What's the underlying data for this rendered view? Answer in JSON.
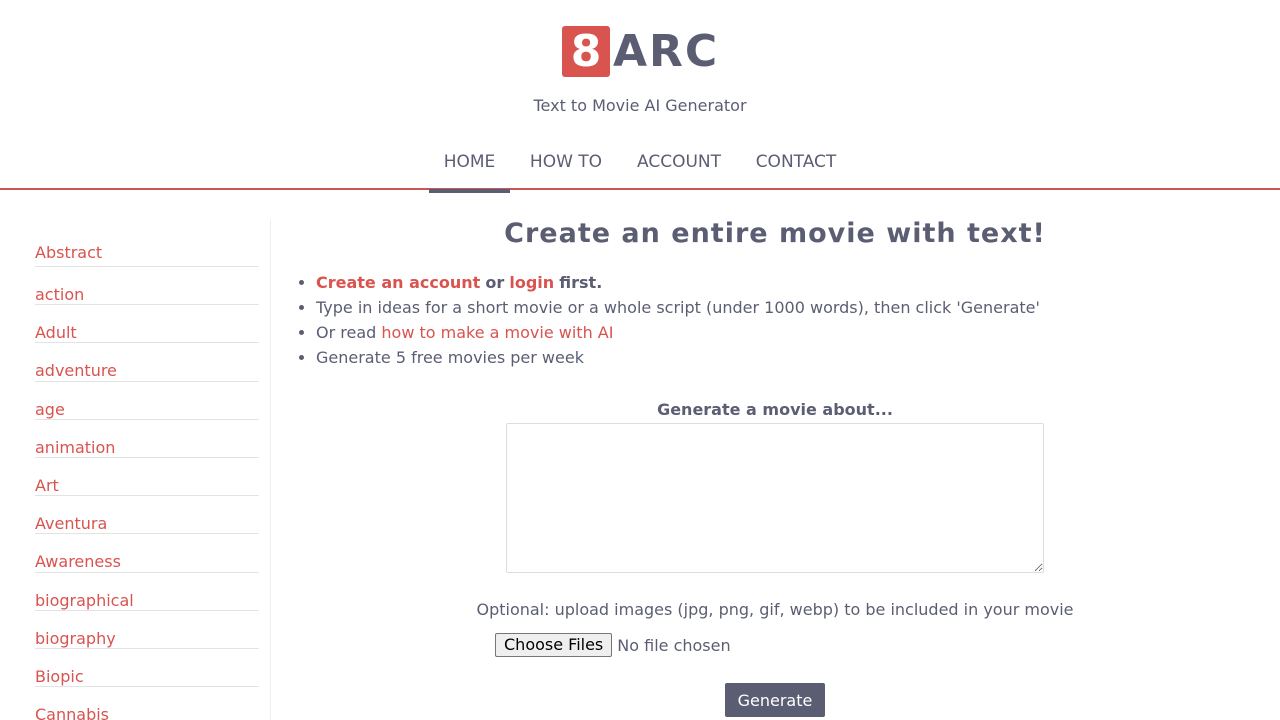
{
  "brand": {
    "logo_number": "8",
    "logo_text": "ARC",
    "tagline": "Text to Movie AI Generator",
    "accent": "#d9534f",
    "text_color": "#5b5e73"
  },
  "nav": {
    "home": "HOME",
    "howto": "HOW TO",
    "account": "ACCOUNT",
    "contact": "CONTACT",
    "active": "HOME"
  },
  "sidebar": {
    "items": [
      "Abstract",
      "action",
      "Adult",
      "adventure",
      "age",
      "animation",
      "Art",
      "Aventura",
      "Awareness",
      "biographical",
      "biography",
      "Biopic",
      "Cannabis"
    ]
  },
  "main": {
    "title": "Create an entire movie with text!",
    "bullet1": {
      "create_link": "Create an account",
      "or": "or",
      "login_link": "login",
      "first": "first."
    },
    "bullet2": "Type in ideas for a short movie or a whole script (under 1000 words), then click 'Generate'",
    "bullet3": {
      "prefix": "Or read",
      "link": "how to make a movie with AI"
    },
    "bullet4": "Generate 5 free movies per week",
    "generate_label": "Generate a movie about...",
    "textarea_value": "",
    "upload_label": "Optional: upload images (jpg, png, gif, webp) to be included in your movie",
    "choose_files": "Choose Files",
    "no_file": "No file chosen",
    "generate_button": "Generate"
  }
}
